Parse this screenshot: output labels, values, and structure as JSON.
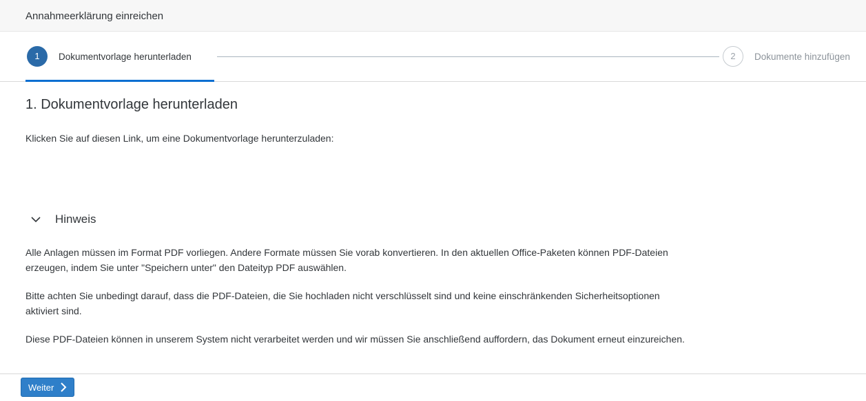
{
  "header": {
    "title": "Annahmeerklärung einreichen"
  },
  "wizard": {
    "steps": [
      {
        "number": "1",
        "label": "Dokumentvorlage herunterladen",
        "active": true
      },
      {
        "number": "2",
        "label": "Dokumente hinzufügen",
        "active": false
      }
    ]
  },
  "content": {
    "section_title": "1. Dokumentvorlage herunterladen",
    "instruction": "Klicken Sie auf diesen Link, um eine Dokumentvorlage herunterzuladen:",
    "hint": {
      "label": "Hinweis",
      "paragraphs": [
        "Alle Anlagen müssen im Format PDF vorliegen. Andere Formate müssen Sie vorab konvertieren. In den aktuellen Office-Paketen können PDF-Dateien erzeugen, indem Sie unter \"Speichern unter\" den Dateityp PDF auswählen.",
        "Bitte achten Sie unbedingt darauf, dass die PDF-Dateien, die Sie hochladen nicht verschlüsselt sind und keine einschränkenden Sicherheitsoptionen aktiviert sind.",
        "Diese PDF-Dateien können in unserem System nicht verarbeitet werden und wir müssen Sie anschließend auffordern, das Dokument erneut einzureichen."
      ]
    }
  },
  "footer": {
    "next_label": "Weiter"
  },
  "colors": {
    "accent": "#0a6ed1",
    "button": "#2f7fc9",
    "step_active": "#2a6aa8"
  }
}
